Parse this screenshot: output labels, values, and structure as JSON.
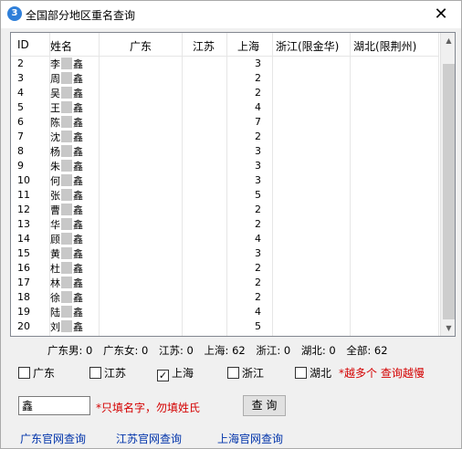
{
  "window": {
    "icon_glyph": "3",
    "title": "全国部分地区重名查询",
    "close_glyph": "✕"
  },
  "table": {
    "columns": [
      "ID",
      "姓名",
      "广东",
      "江苏",
      "上海",
      "浙江(限金华)",
      "湖北(限荆州)"
    ],
    "rows": [
      {
        "id": "2",
        "surname": "李",
        "given": "鑫",
        "guangdong": "",
        "jiangsu": "",
        "shanghai": "3",
        "zhejiang": "",
        "hubei": ""
      },
      {
        "id": "3",
        "surname": "周",
        "given": "鑫",
        "guangdong": "",
        "jiangsu": "",
        "shanghai": "2",
        "zhejiang": "",
        "hubei": ""
      },
      {
        "id": "4",
        "surname": "吴",
        "given": "鑫",
        "guangdong": "",
        "jiangsu": "",
        "shanghai": "2",
        "zhejiang": "",
        "hubei": ""
      },
      {
        "id": "5",
        "surname": "王",
        "given": "鑫",
        "guangdong": "",
        "jiangsu": "",
        "shanghai": "4",
        "zhejiang": "",
        "hubei": ""
      },
      {
        "id": "6",
        "surname": "陈",
        "given": "鑫",
        "guangdong": "",
        "jiangsu": "",
        "shanghai": "7",
        "zhejiang": "",
        "hubei": ""
      },
      {
        "id": "7",
        "surname": "沈",
        "given": "鑫",
        "guangdong": "",
        "jiangsu": "",
        "shanghai": "2",
        "zhejiang": "",
        "hubei": ""
      },
      {
        "id": "8",
        "surname": "杨",
        "given": "鑫",
        "guangdong": "",
        "jiangsu": "",
        "shanghai": "3",
        "zhejiang": "",
        "hubei": ""
      },
      {
        "id": "9",
        "surname": "朱",
        "given": "鑫",
        "guangdong": "",
        "jiangsu": "",
        "shanghai": "3",
        "zhejiang": "",
        "hubei": ""
      },
      {
        "id": "10",
        "surname": "何",
        "given": "鑫",
        "guangdong": "",
        "jiangsu": "",
        "shanghai": "3",
        "zhejiang": "",
        "hubei": ""
      },
      {
        "id": "11",
        "surname": "张",
        "given": "鑫",
        "guangdong": "",
        "jiangsu": "",
        "shanghai": "5",
        "zhejiang": "",
        "hubei": ""
      },
      {
        "id": "12",
        "surname": "曹",
        "given": "鑫",
        "guangdong": "",
        "jiangsu": "",
        "shanghai": "2",
        "zhejiang": "",
        "hubei": ""
      },
      {
        "id": "13",
        "surname": "华",
        "given": "鑫",
        "guangdong": "",
        "jiangsu": "",
        "shanghai": "2",
        "zhejiang": "",
        "hubei": ""
      },
      {
        "id": "14",
        "surname": "顾",
        "given": "鑫",
        "guangdong": "",
        "jiangsu": "",
        "shanghai": "4",
        "zhejiang": "",
        "hubei": ""
      },
      {
        "id": "15",
        "surname": "黄",
        "given": "鑫",
        "guangdong": "",
        "jiangsu": "",
        "shanghai": "3",
        "zhejiang": "",
        "hubei": ""
      },
      {
        "id": "16",
        "surname": "杜",
        "given": "鑫",
        "guangdong": "",
        "jiangsu": "",
        "shanghai": "2",
        "zhejiang": "",
        "hubei": ""
      },
      {
        "id": "17",
        "surname": "林",
        "given": "鑫",
        "guangdong": "",
        "jiangsu": "",
        "shanghai": "2",
        "zhejiang": "",
        "hubei": ""
      },
      {
        "id": "18",
        "surname": "徐",
        "given": "鑫",
        "guangdong": "",
        "jiangsu": "",
        "shanghai": "2",
        "zhejiang": "",
        "hubei": ""
      },
      {
        "id": "19",
        "surname": "陆",
        "given": "鑫",
        "guangdong": "",
        "jiangsu": "",
        "shanghai": "4",
        "zhejiang": "",
        "hubei": ""
      },
      {
        "id": "20",
        "surname": "刘",
        "given": "鑫",
        "guangdong": "",
        "jiangsu": "",
        "shanghai": "5",
        "zhejiang": "",
        "hubei": ""
      }
    ]
  },
  "scrollbar": {
    "up_glyph": "▲",
    "down_glyph": "▼"
  },
  "summary": {
    "guangdong_male": "广东男: 0",
    "guangdong_female": "广东女: 0",
    "jiangsu": "江苏: 0",
    "shanghai": "上海: 62",
    "zhejiang": "浙江: 0",
    "hubei": "湖北: 0",
    "total": "全部: 62"
  },
  "filters": [
    {
      "label": "广东",
      "checked": false
    },
    {
      "label": "江苏",
      "checked": false
    },
    {
      "label": "上海",
      "checked": true
    },
    {
      "label": "浙江",
      "checked": false
    },
    {
      "label": "湖北",
      "checked": false
    }
  ],
  "checkmark_glyph": "✓",
  "warning": "*越多个 查询越慢",
  "search": {
    "value": "鑫",
    "hint": "*只填名字，勿填姓氏",
    "button_label": "查 询"
  },
  "links": [
    "广东官网查询",
    "江苏官网查询",
    "上海官网查询"
  ],
  "colors": {
    "warning": "#d40000",
    "link": "#0033aa"
  }
}
